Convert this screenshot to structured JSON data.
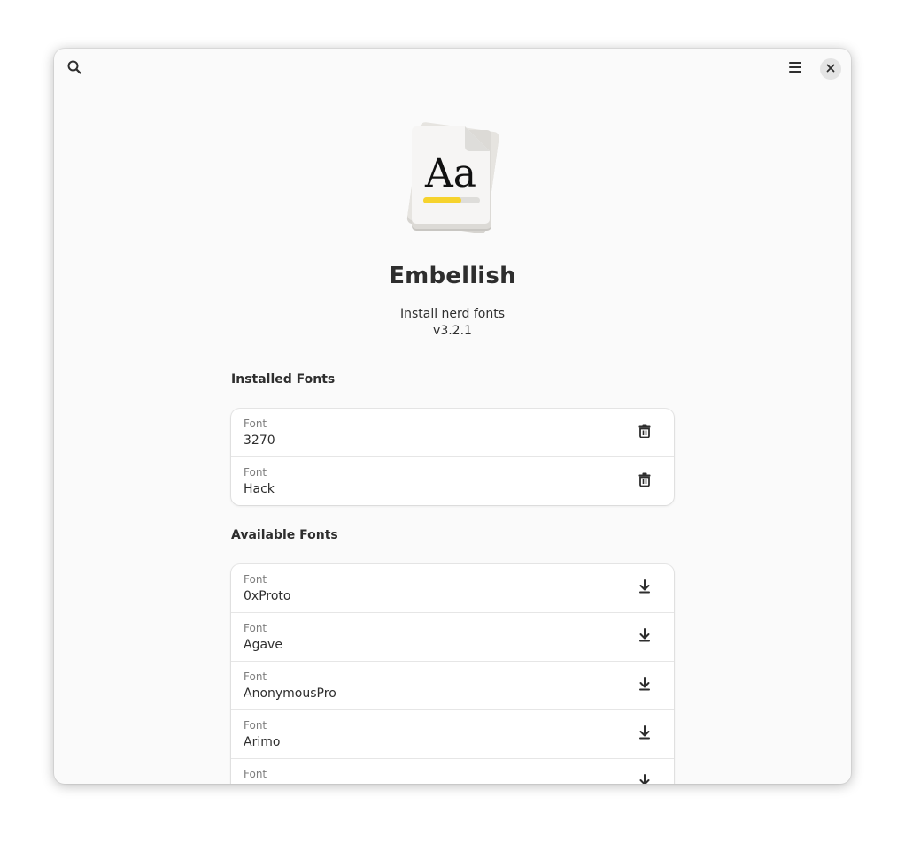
{
  "header": {
    "search_icon": "search-icon",
    "menu_icon": "hamburger-menu-icon",
    "close_icon": "close-icon"
  },
  "app": {
    "icon": "font-document-icon",
    "icon_glyph": "Aa",
    "name": "Embellish",
    "description": "Install nerd fonts",
    "version": "v3.2.1"
  },
  "installed": {
    "title": "Installed Fonts",
    "action_icon": "trash-icon",
    "items": [
      {
        "subtitle": "Font",
        "name": "3270"
      },
      {
        "subtitle": "Font",
        "name": "Hack"
      }
    ]
  },
  "available": {
    "title": "Available Fonts",
    "action_icon": "download-icon",
    "items": [
      {
        "subtitle": "Font",
        "name": "0xProto"
      },
      {
        "subtitle": "Font",
        "name": "Agave"
      },
      {
        "subtitle": "Font",
        "name": "AnonymousPro"
      },
      {
        "subtitle": "Font",
        "name": "Arimo"
      },
      {
        "subtitle": "Font",
        "name": ""
      }
    ]
  },
  "colors": {
    "window_bg": "#fafafa",
    "text": "#2e2e2e",
    "subtext": "#7e7e7e",
    "accent_yellow": "#f6d32d"
  }
}
